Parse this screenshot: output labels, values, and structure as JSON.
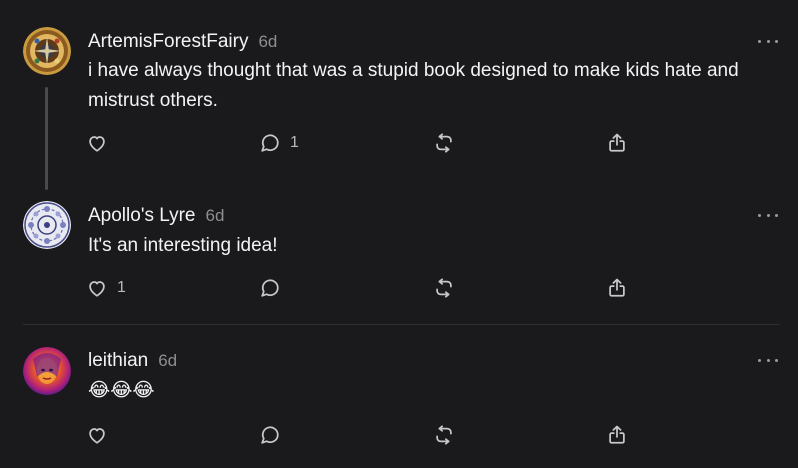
{
  "posts": [
    {
      "username": "ArtemisForestFairy",
      "time": "6d",
      "text": "i have always thought that was a stupid book designed to make kids hate and mistrust others.",
      "like_count": "",
      "reply_count": "1"
    },
    {
      "username": "Apollo's Lyre",
      "time": "6d",
      "text": "It's an interesting idea!",
      "like_count": "1",
      "reply_count": ""
    },
    {
      "username": "leithian",
      "time": "6d",
      "text": "😂😂😂",
      "like_count": "",
      "reply_count": ""
    }
  ],
  "icons": {
    "like": "heart-icon",
    "reply": "comment-icon",
    "repost": "repost-icon",
    "share": "share-icon",
    "more": "more-options-icon"
  },
  "colors": {
    "background": "#1a1a1c",
    "text": "#f3f3f5",
    "muted": "#8e8e93",
    "icon": "#c7c7cc"
  }
}
